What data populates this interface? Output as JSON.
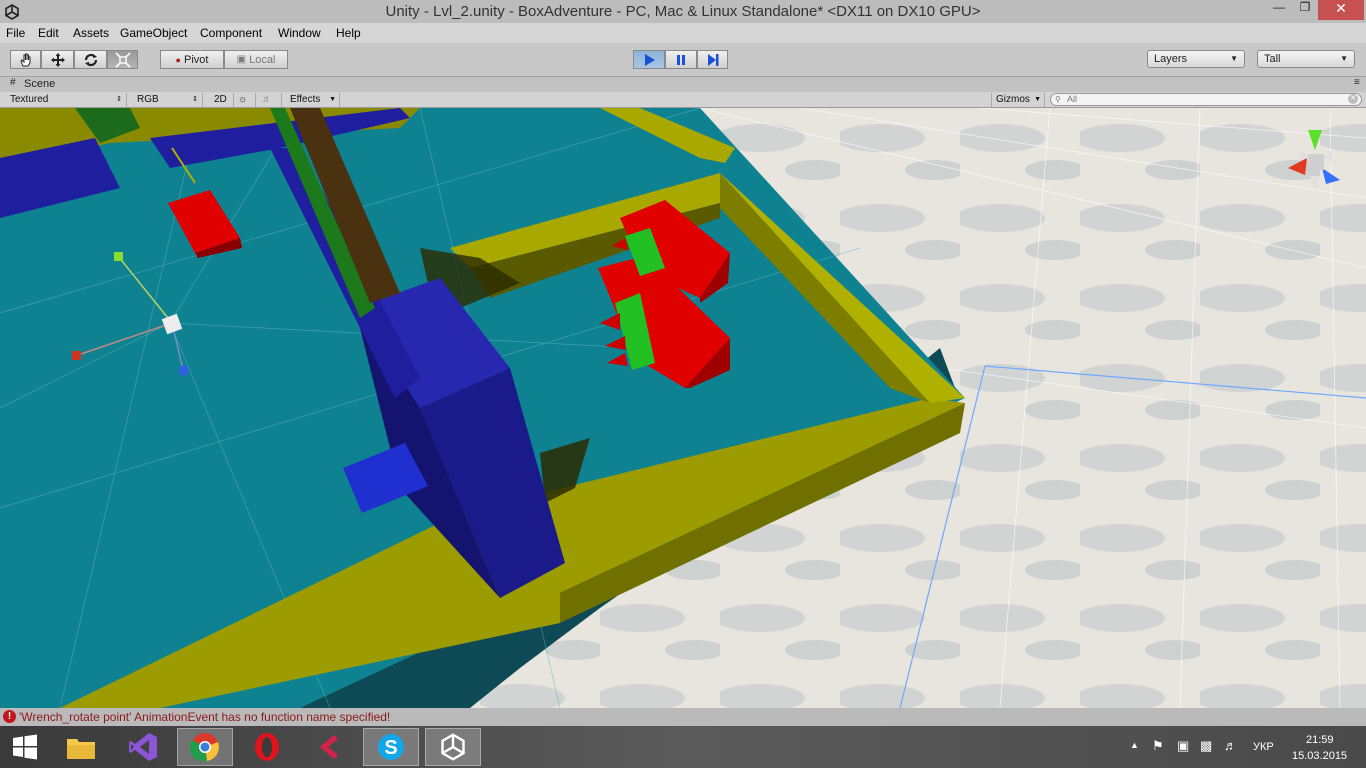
{
  "window": {
    "title": "Unity - Lvl_2.unity - BoxAdventure - PC, Mac & Linux Standalone* <DX11 on DX10 GPU>"
  },
  "menu": [
    "File",
    "Edit",
    "Assets",
    "GameObject",
    "Component",
    "Window",
    "Help"
  ],
  "toolbar": {
    "pivot_label": "Pivot",
    "local_label": "Local",
    "layers_label": "Layers",
    "layout_label": "Tall"
  },
  "scene": {
    "tab_label": "Scene",
    "render_mode": "Textured",
    "color_mode": "RGB",
    "mode_2d": "2D",
    "effects_label": "Effects",
    "gizmos_label": "Gizmos",
    "search_placeholder": "All"
  },
  "status": {
    "message": "'Wrench_rotate point' AnimationEvent has no function name specified!"
  },
  "taskbar": {
    "language": "УКР",
    "time": "21:59",
    "date": "15.03.2015"
  },
  "colors": {
    "floor": "#0f8292",
    "wall_yellow": "#9a9a00",
    "block_blue": "#1e1e9e",
    "block_red": "#e00000",
    "sky": "#e6e3dc"
  }
}
